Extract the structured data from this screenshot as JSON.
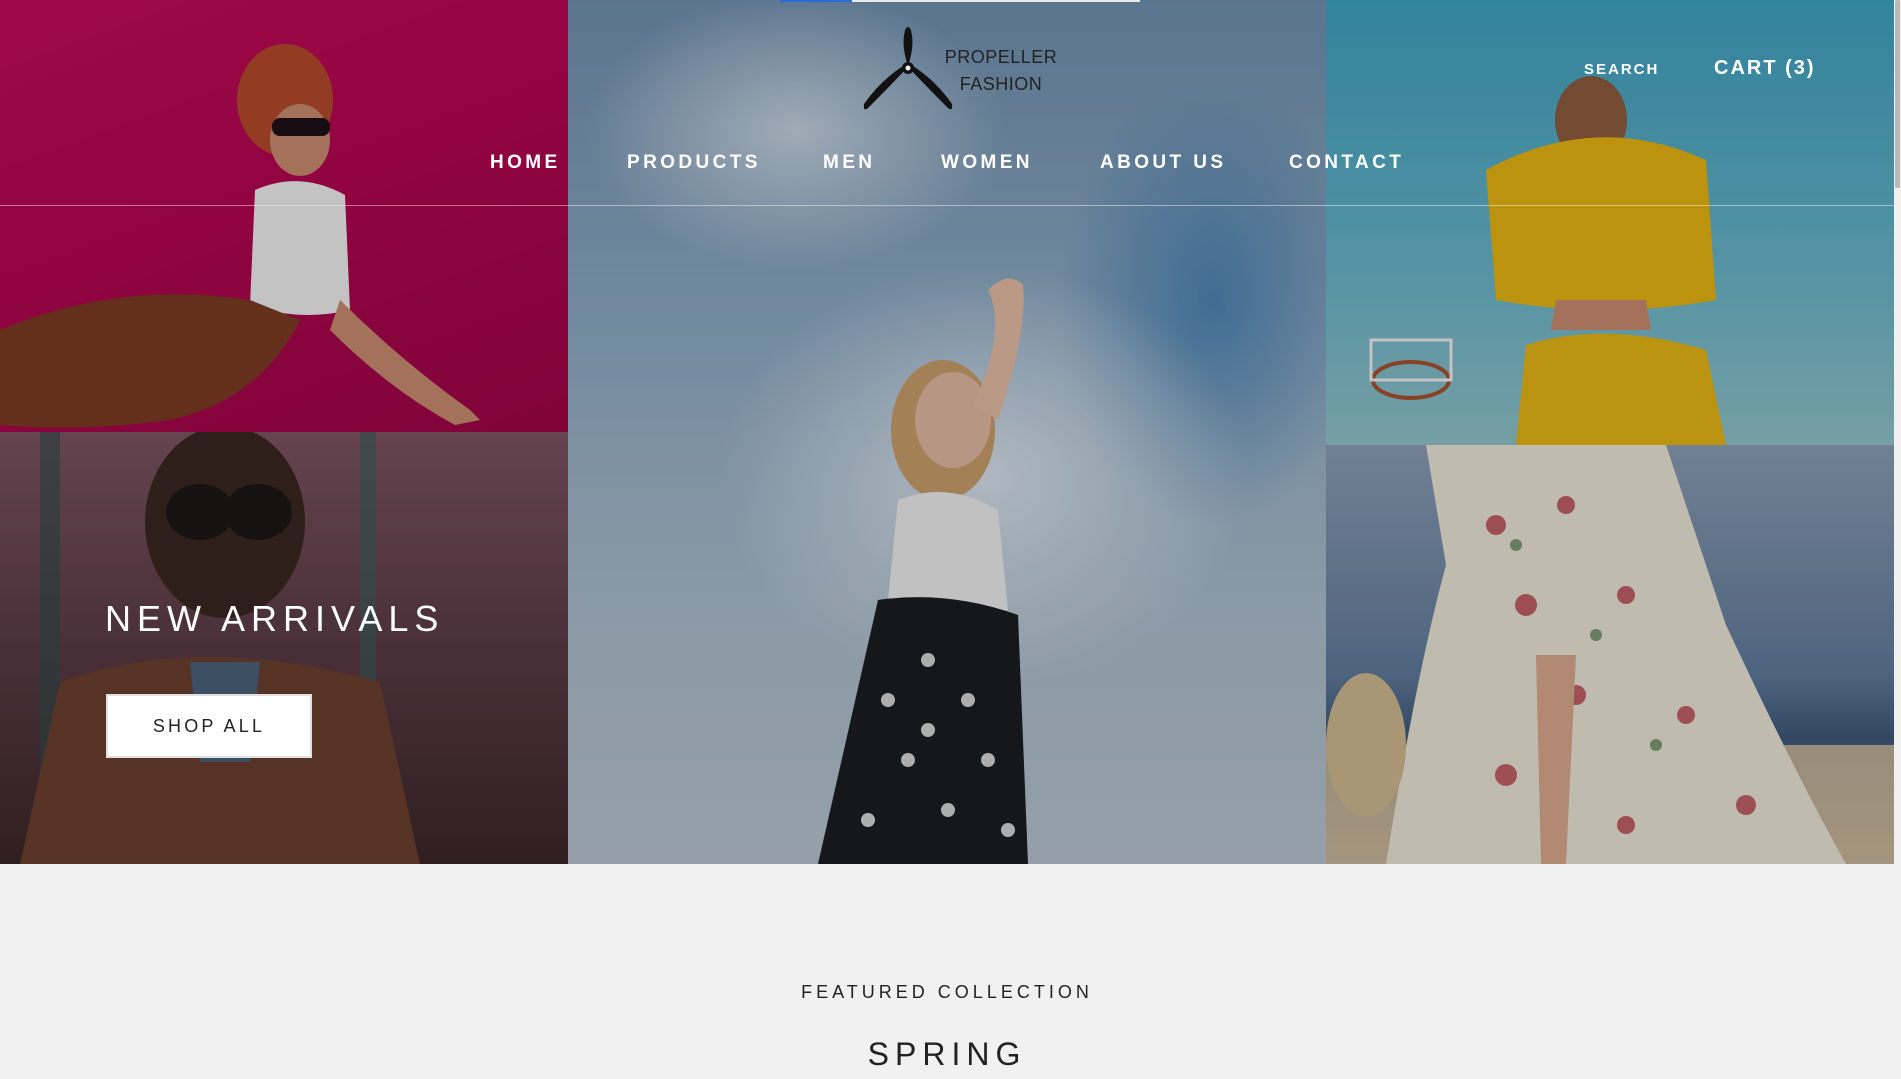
{
  "brand": {
    "name_line1": "PROPELLER",
    "name_line2": "FASHION",
    "logo_icon": "propeller-icon"
  },
  "header": {
    "search_label": "SEARCH",
    "cart_label": "CART (3)",
    "top_progress_fraction": 0.2
  },
  "nav": {
    "items": [
      {
        "label": "HOME"
      },
      {
        "label": "PRODUCTS"
      },
      {
        "label": "MEN"
      },
      {
        "label": "WOMEN"
      },
      {
        "label": "ABOUT US"
      },
      {
        "label": "CONTACT"
      }
    ]
  },
  "hero": {
    "title": "NEW ARRIVALS",
    "cta_label": "SHOP ALL",
    "images": [
      "woman-in-pink-studio-photo",
      "man-in-sunglasses-photo",
      "woman-against-clouds-photo",
      "woman-in-yellow-hoodie-photo",
      "woman-in-floral-dress-photo"
    ]
  },
  "featured": {
    "eyebrow": "FEATURED COLLECTION",
    "title": "SPRING"
  },
  "colors": {
    "pink_tile": "#c40b58",
    "teal_tile": "#3ea0c0",
    "link_accent": "#2a6cd6",
    "text_dark": "#222222",
    "page_bg": "#f1f1f1"
  }
}
